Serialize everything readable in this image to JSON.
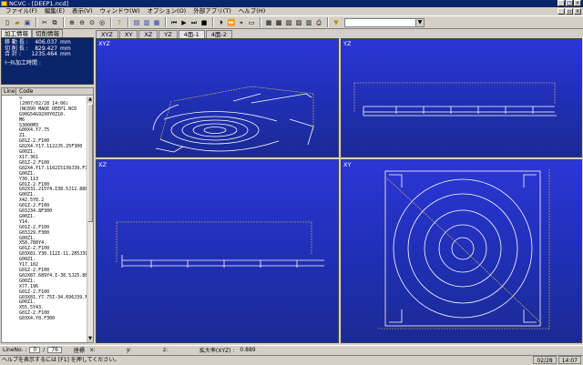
{
  "window": {
    "title": "NCVC - [DEEP1.ncd]"
  },
  "menu": [
    "ファイル(F)",
    "編集(E)",
    "表示(V)",
    "ウィンドウ(W)",
    "オプション(O)",
    "外部アプリ(T)",
    "ヘルプ(H)"
  ],
  "toolbar": {
    "combo_value": ""
  },
  "left_tabs": [
    "加工情報",
    "切削情報"
  ],
  "info": {
    "rows": [
      {
        "label": "移 動 長 :",
        "value": "406.037",
        "unit": "mm"
      },
      {
        "label": "切 削 長 :",
        "value": "829.427",
        "unit": "mm"
      },
      {
        "label": "合    計 :",
        "value": "1235.464",
        "unit": "mm"
      }
    ],
    "time_label": "ﾄｰﾀﾙ加工時間 :"
  },
  "code": {
    "col_line": "Line",
    "col_code": "Code",
    "lines": [
      "%",
      "(2007/02/28 14:06)",
      "(NC890 MADE DEEP1.NCD",
      "G90G54G92X0Y0Z10.",
      "M6",
      "S3000M3",
      "G00X4.Y7.75",
      "Z1.",
      "G01Z-2.F100",
      "G02X4.Y17.1122J5.25F300",
      "G00Z1.",
      "X17.361",
      "G01Z-2.F100",
      "G02X4.Y17.1102I5139J39.F300",
      "G00Z1.",
      "Y30.113",
      "G01Z-2.F100",
      "G02X31.215Y4.I38.5J12.888F300",
      "G00Z1.",
      "X42.5Y8.2",
      "G01Z-2.F100",
      "G03J34.8F300",
      "G00Z1.",
      "Y14.",
      "G01Z-2.F100",
      "G03J29.F300",
      "G00Z1.",
      "X58.788Y4.",
      "G01Z-2.F100",
      "G03X81.Y30.112I-11.285J39.F",
      "G00Z1.",
      "Y17.102",
      "G01Z-2.F100",
      "G02X87.689Y4.I-38.5J25.888F",
      "G00Z1.",
      "X77.196",
      "G01Z-2.F100",
      "G03X81.Y7.75I-34.696J39.F3",
      "G00Z1.",
      "X55.5Y43.",
      "G01Z-2.F100",
      "G03X4.Y0.F300"
    ]
  },
  "views": {
    "tabs": [
      "XYZ",
      "XY",
      "XZ",
      "YZ",
      "4面-1",
      "4面-2"
    ],
    "active_tab": "4面-1",
    "labels": {
      "xyz": "XYZ",
      "yz": "YZ",
      "xz": "XZ",
      "xy": "XY"
    }
  },
  "status": {
    "line_label": "LineNo. :",
    "line_no": "0",
    "line_sep": "/",
    "line_total": "76",
    "coord_label": "座標",
    "x_label": "x:",
    "y_label": "y:",
    "z_label": "z:",
    "zoom_label": "拡大率(XYZ) :",
    "zoom_value": "0.889"
  },
  "help": {
    "text": "ヘルプを表示するには [F1] を押してください。",
    "date": "02/28",
    "time": "14:07"
  },
  "colors": {
    "view_bg": "#1f2fb4",
    "path": "#ffffff",
    "rapid": "#d8c060",
    "titlebar": "#0a246a"
  }
}
